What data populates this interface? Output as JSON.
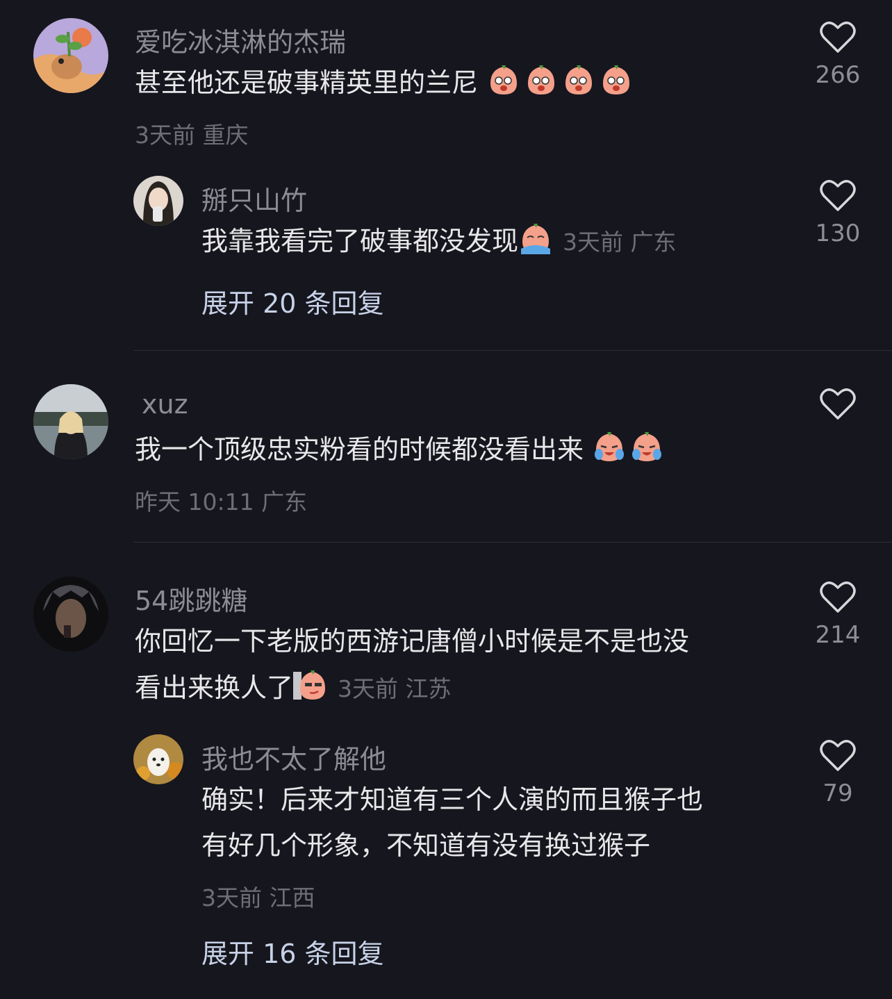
{
  "comments": [
    {
      "username": "爱吃冰淇淋的杰瑞",
      "content": "甚至他还是破事精英里的兰尼",
      "emojis": [
        "drooling-face-icon",
        "drooling-face-icon",
        "drooling-face-icon",
        "drooling-face-icon"
      ],
      "time": "3天前",
      "location": "重庆",
      "likes": "266",
      "reply": {
        "username": "掰只山竹",
        "content": "我靠我看完了破事都没发现",
        "emojis": [
          "crying-face-icon"
        ],
        "time": "3天前",
        "location": "广东",
        "likes": "130"
      },
      "expand_label": "展开 20 条回复"
    },
    {
      "username": "xuz",
      "content": "我一个顶级忠实粉看的时候都没看出来",
      "emojis": [
        "laugh-cry-face-icon",
        "laugh-cry-face-icon"
      ],
      "time": "昨天 10:11",
      "location": "广东",
      "likes": ""
    },
    {
      "username": "54跳跳糖",
      "content_line1": "你回忆一下老版的西游记唐僧小时候是不是也没",
      "content_line2": "看出来换人了",
      "emojis": [
        "smirk-face-icon"
      ],
      "time": "3天前",
      "location": "江苏",
      "likes": "214",
      "reply": {
        "username": "我也不太了解他",
        "content_line1": "确实！后来才知道有三个人演的而且猴子也",
        "content_line2": "有好几个形象，不知道有没有换过猴子",
        "time": "3天前",
        "location": "江西",
        "likes": "79"
      },
      "expand_label": "展开 16 条回复"
    }
  ],
  "colors": {
    "background": "#16161e",
    "username": "#8c8c93",
    "content": "#e8e8ea",
    "meta": "#6e6e76",
    "expand": "#c7d2e8"
  }
}
